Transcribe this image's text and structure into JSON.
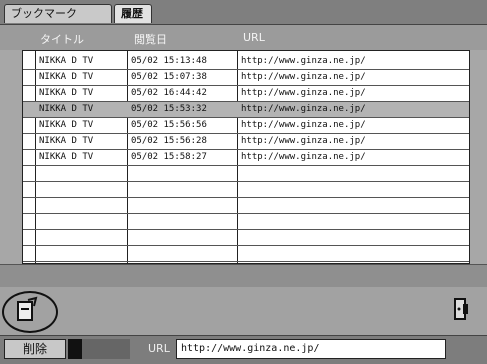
{
  "tabs": [
    {
      "label": "ブックマーク"
    },
    {
      "label": "履歴"
    }
  ],
  "columns": {
    "title": "タイトル",
    "date": "閲覧日",
    "url": "URL"
  },
  "rows": [
    {
      "title": "NIKKA D TV",
      "date": "05/02 15:13:48",
      "url": "http://www.ginza.ne.jp/"
    },
    {
      "title": "NIKKA D TV",
      "date": "05/02 15:07:38",
      "url": "http://www.ginza.ne.jp/"
    },
    {
      "title": "NIKKA D TV",
      "date": "05/02 16:44:42",
      "url": "http://www.ginza.ne.jp/"
    },
    {
      "title": "NIKKA D TV",
      "date": "05/02 15:53:32",
      "url": "http://www.ginza.ne.jp/"
    },
    {
      "title": "NIKKA D TV",
      "date": "05/02 15:56:56",
      "url": "http://www.ginza.ne.jp/"
    },
    {
      "title": "NIKKA D TV",
      "date": "05/02 15:56:28",
      "url": "http://www.ginza.ne.jp/"
    },
    {
      "title": "NIKKA D TV",
      "date": "05/02 15:58:27",
      "url": "http://www.ginza.ne.jp/"
    }
  ],
  "empty_rows": 6,
  "selected_row": 3,
  "footer": {
    "delete_label": "削除",
    "url_label": "URL",
    "url_value": "http://www.ginza.ne.jp/"
  },
  "icons": {
    "left": "page-icon",
    "right": "door-icon"
  },
  "colors": {
    "selection": "#b3b3b3",
    "table_bg": "#ffffff"
  }
}
